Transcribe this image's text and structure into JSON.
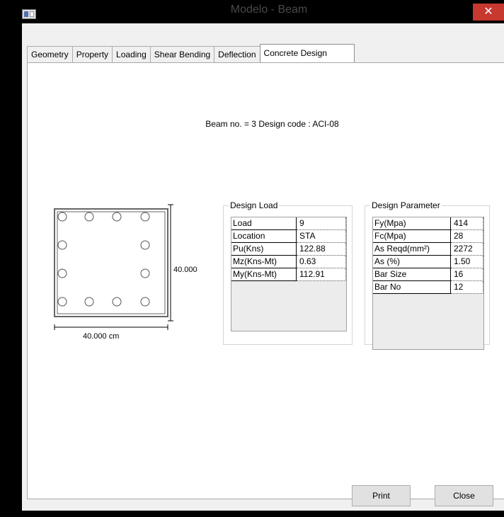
{
  "window": {
    "title": "Modelo - Beam",
    "close_label": "✕"
  },
  "tabs": [
    {
      "label": "Geometry"
    },
    {
      "label": "Property"
    },
    {
      "label": "Loading"
    },
    {
      "label": "Shear Bending"
    },
    {
      "label": "Deflection"
    },
    {
      "label": "Concrete Design"
    }
  ],
  "header": {
    "text": "Beam no. = 3  Design code :  ACI-08"
  },
  "section": {
    "height_dim": "40.000",
    "width_dim": "40.000 cm"
  },
  "design_load": {
    "title": "Design Load",
    "rows": [
      {
        "label": "Load",
        "value": "9"
      },
      {
        "label": "Location",
        "value": "STA"
      },
      {
        "label": "Pu(Kns)",
        "value": "122.88"
      },
      {
        "label": "Mz(Kns-Mt)",
        "value": "0.63"
      },
      {
        "label": "My(Kns-Mt)",
        "value": "112.91"
      }
    ]
  },
  "design_parameter": {
    "title": "Design Parameter",
    "rows": [
      {
        "label": "Fy(Mpa)",
        "value": "414"
      },
      {
        "label": "Fc(Mpa)",
        "value": "28"
      },
      {
        "label": "As Reqd(mm²)",
        "value": "2272"
      },
      {
        "label": "As (%)",
        "value": "1.50"
      },
      {
        "label": "Bar Size",
        "value": "16"
      },
      {
        "label": "Bar No",
        "value": "12"
      }
    ]
  },
  "buttons": {
    "print": "Print",
    "close": "Close"
  }
}
